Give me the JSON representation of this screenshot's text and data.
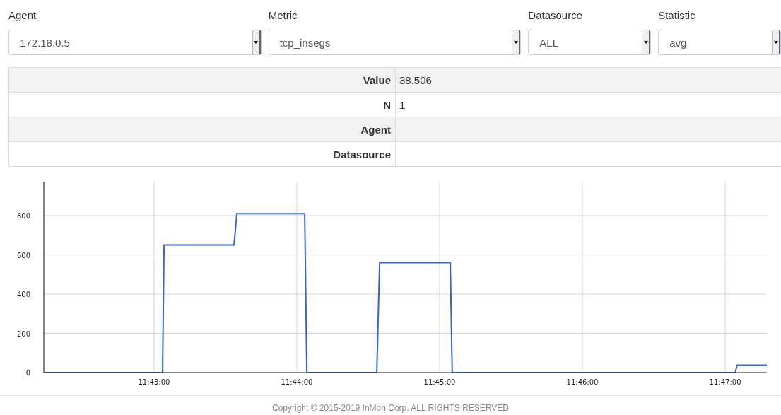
{
  "filters": [
    {
      "label": "Agent",
      "value": "172.18.0.5"
    },
    {
      "label": "Metric",
      "value": "tcp_insegs"
    },
    {
      "label": "Datasource",
      "value": "ALL"
    },
    {
      "label": "Statistic",
      "value": "avg"
    }
  ],
  "details": [
    {
      "label": "Value",
      "value": "38.506"
    },
    {
      "label": "N",
      "value": "1"
    },
    {
      "label": "Agent"
    },
    {
      "label": "Datasource"
    }
  ],
  "chart": {
    "chart_data": {
      "type": "line",
      "x": [
        42134,
        42183.6,
        42184.2,
        42213.6,
        42214.8,
        42243.3,
        42244.2,
        42273.6,
        42274.8,
        42304.5,
        42305.3,
        42424.2,
        42425,
        42437.5
      ],
      "series": [
        {
          "color": "#3366cc",
          "values": [
            0,
            0,
            650,
            650,
            810,
            810,
            0,
            0,
            560,
            560,
            0,
            0,
            38,
            38
          ]
        }
      ],
      "xlim": [
        42133.7,
        42437.5
      ],
      "ylim": [
        0,
        973
      ],
      "xticks": [
        {
          "value": 42180,
          "label": "11:43:00"
        },
        {
          "value": 42240,
          "label": "11:44:00"
        },
        {
          "value": 42300,
          "label": "11:45:00"
        },
        {
          "value": 42360,
          "label": "11:46:00"
        },
        {
          "value": 42420,
          "label": "11:47:00"
        }
      ],
      "yticks": [
        0,
        200,
        400,
        600,
        800
      ],
      "grid": true
    }
  },
  "footer": "Copyright © 2015-2019 InMon Corp. ALL RIGHTS RESERVED"
}
